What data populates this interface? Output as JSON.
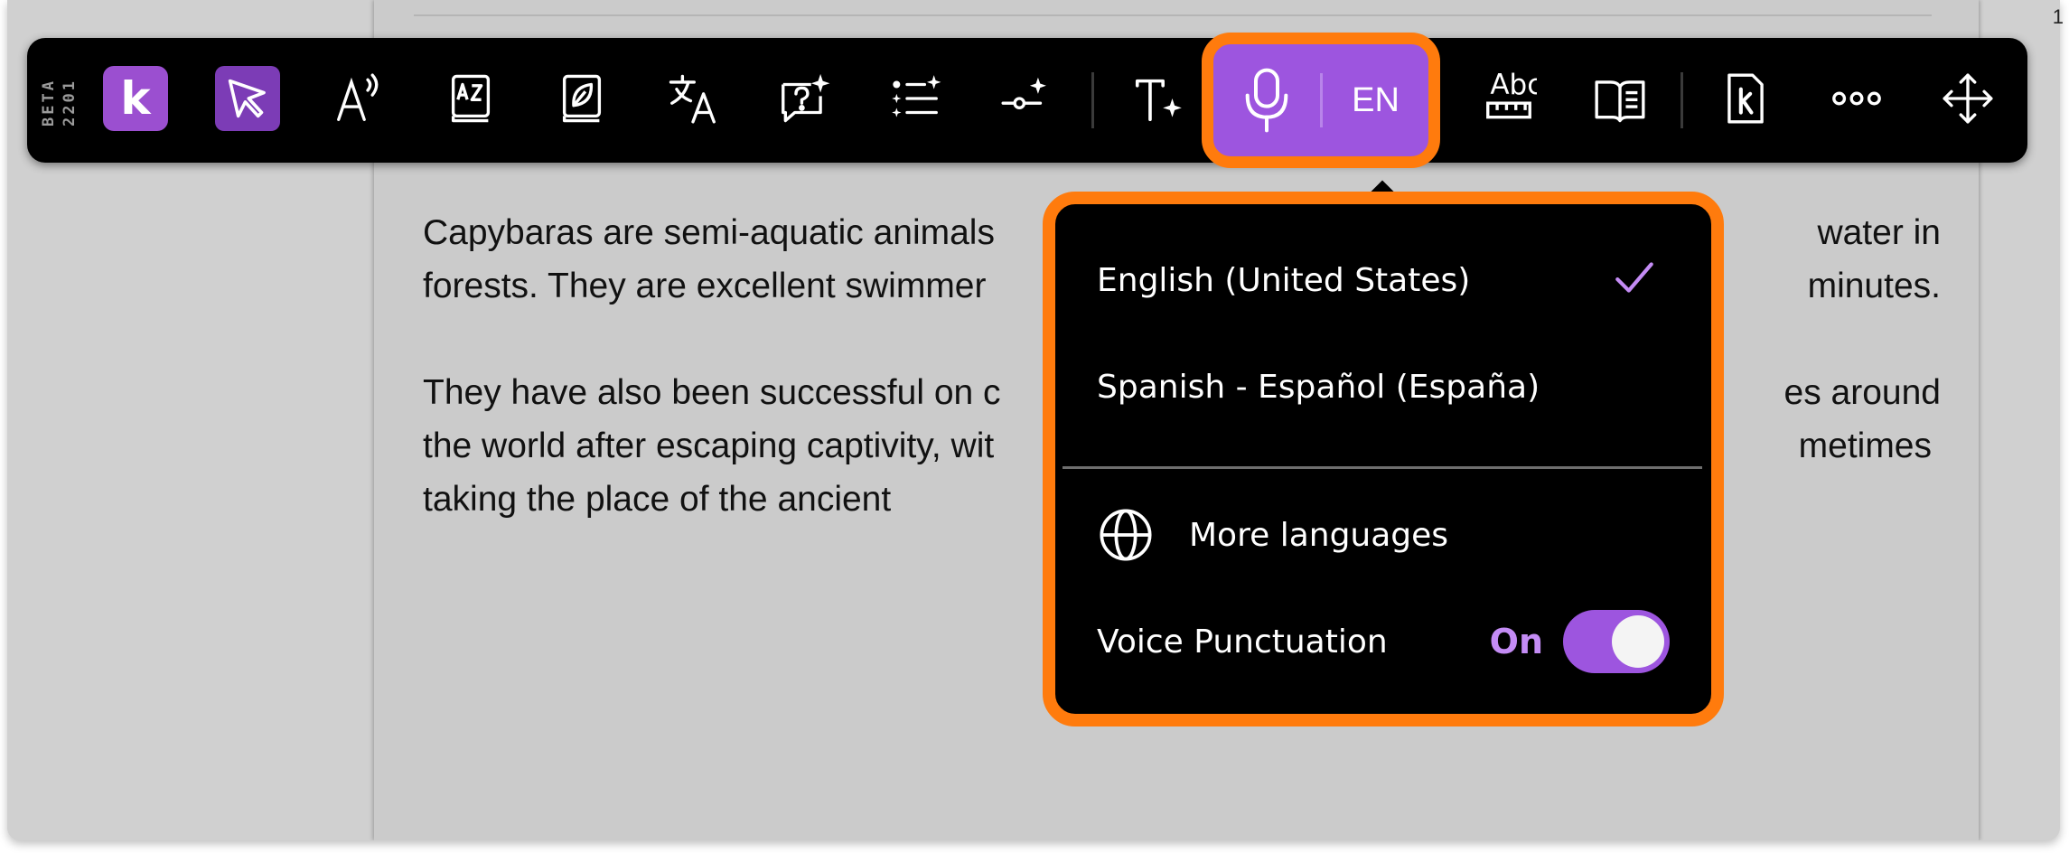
{
  "page_number": "1",
  "toolbar": {
    "beta_label": "BETA",
    "build_number": "2201",
    "logo_letter": "k",
    "language_code": "EN",
    "spelling_abc": "Abc",
    "items": [
      {
        "name": "select-cursor-icon"
      },
      {
        "name": "read-aloud-icon"
      },
      {
        "name": "dictionary-icon"
      },
      {
        "name": "picture-dictionary-icon"
      },
      {
        "name": "translate-icon"
      },
      {
        "name": "question-ai-icon"
      },
      {
        "name": "list-ai-icon"
      },
      {
        "name": "slider-ai-icon"
      },
      {
        "name": "text-ai-icon"
      },
      {
        "name": "microphone-icon"
      },
      {
        "name": "spell-check-icon"
      },
      {
        "name": "reader-icon"
      },
      {
        "name": "kami-doc-icon"
      },
      {
        "name": "more-icon"
      },
      {
        "name": "move-icon"
      }
    ]
  },
  "document": {
    "paragraphs": [
      [
        "Capybaras are semi-aquatic animals",
        "water in"
      ],
      [
        "forests. They are excellent swimmer",
        "minutes."
      ],
      [
        "They have also been successful on c",
        "es around"
      ],
      [
        "the world after escaping captivity, wit",
        "metimes"
      ],
      [
        "taking the place of the ancient",
        ""
      ]
    ]
  },
  "dictation_menu": {
    "languages": [
      {
        "label": "English (United States)",
        "selected": true
      },
      {
        "label": "Spanish - Español (España)",
        "selected": false
      }
    ],
    "more_languages_label": "More languages",
    "voice_punctuation": {
      "label": "Voice Punctuation",
      "state_label": "On",
      "enabled": true
    }
  },
  "colors": {
    "accent_purple": "#9d55df",
    "highlight_orange": "#ff7b0d",
    "toolbar_bg": "#000000",
    "check_purple": "#c48cf5"
  }
}
